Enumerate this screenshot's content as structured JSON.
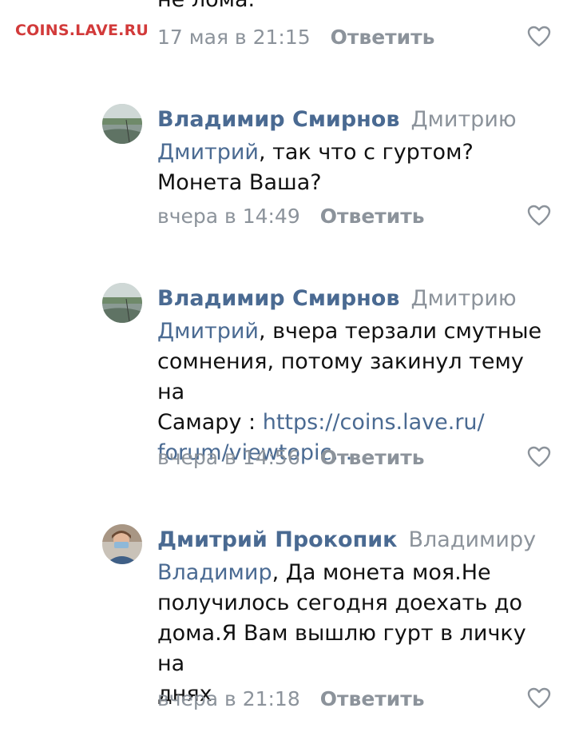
{
  "watermark": "COINS.LAVE.RU",
  "previous_comment": {
    "cut_text": "не лома.",
    "time": "17 мая в 21:15",
    "reply_label": "Ответить"
  },
  "comments": [
    {
      "author": "Владимир Смирнов",
      "reply_to": "Дмитрию",
      "mention": "Дмитрий",
      "text": ", так что с гуртом?",
      "text_line2": "Монета Ваша?",
      "time": "вчера в 14:49",
      "reply_label": "Ответить"
    },
    {
      "author": "Владимир Смирнов",
      "reply_to": "Дмитрию",
      "mention": "Дмитрий",
      "text_line1": ", вчера терзали смутные",
      "text_line2": "сомнения, потому закинул тему на",
      "text_line3": "Самару  : ",
      "link_line1": "https://coins.lave.ru/",
      "link_line2": "forum/viewtopic...",
      "time": "вчера в 14:56",
      "reply_label": "Ответить"
    },
    {
      "author": "Дмитрий Прокопик",
      "reply_to": "Владимиру",
      "mention": "Владимир",
      "text_line1": ", Да монета моя.Не",
      "text_line2": "получилось сегодня доехать до",
      "text_line3": "дома.Я Вам вышлю гурт в личку на",
      "text_line4": "днях",
      "time": "вчера в 21:18",
      "reply_label": "Ответить"
    }
  ],
  "icons": {
    "like": "heart-outline-icon"
  },
  "colors": {
    "author": "#4a6a92",
    "meta": "#8c939b",
    "text": "#111111",
    "watermark": "#d23a3a"
  }
}
